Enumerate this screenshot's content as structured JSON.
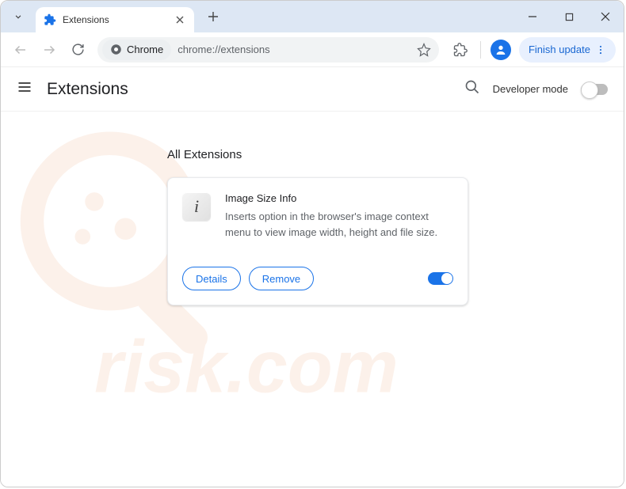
{
  "tab": {
    "title": "Extensions"
  },
  "addressbar": {
    "chip": "Chrome",
    "url": "chrome://extensions"
  },
  "toolbar": {
    "finish_update": "Finish update"
  },
  "page": {
    "title": "Extensions",
    "developer_mode_label": "Developer mode",
    "section_title": "All Extensions"
  },
  "extension": {
    "name": "Image Size Info",
    "description": "Inserts option in the browser's image context menu to view image width, height and file size.",
    "details_label": "Details",
    "remove_label": "Remove"
  }
}
